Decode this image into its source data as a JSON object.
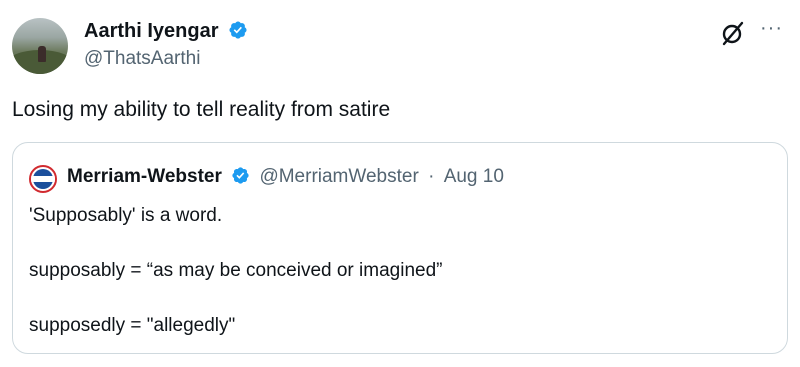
{
  "author": {
    "name": "Aarthi Iyengar",
    "handle": "@ThatsAarthi"
  },
  "tweet": {
    "text": "Losing my ability to tell reality from satire"
  },
  "quote": {
    "name": "Merriam-Webster",
    "handle": "@MerriamWebster",
    "separator": "·",
    "date": "Aug 10",
    "lines": [
      "'Supposably' is a word.",
      "supposably = “as may be conceived or imagined”",
      "supposedly = \"allegedly\""
    ]
  },
  "icons": {
    "verified": "verified-badge-icon",
    "grok": "grok-icon",
    "more": "more-icon",
    "avatar_logo": "merriam-webster-logo"
  },
  "colors": {
    "verified": "#1d9bf0",
    "text_primary": "#0f1419",
    "text_secondary": "#536471",
    "border": "#cfd9de"
  }
}
